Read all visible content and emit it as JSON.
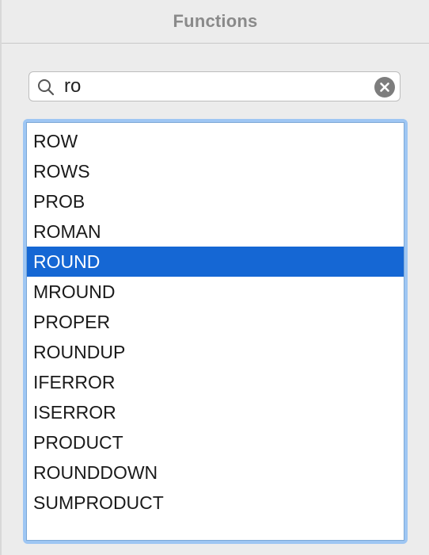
{
  "header": {
    "title": "Functions"
  },
  "search": {
    "value": "ro",
    "icon": "magnifying-glass-icon",
    "clear_icon": "clear-x-circle-icon"
  },
  "list": {
    "selected": "ROUND",
    "items": [
      "ROW",
      "ROWS",
      "PROB",
      "ROMAN",
      "ROUND",
      "MROUND",
      "PROPER",
      "ROUNDUP",
      "IFERROR",
      "ISERROR",
      "PRODUCT",
      "ROUNDDOWN",
      "SUMPRODUCT"
    ]
  },
  "colors": {
    "selection": "#1567d4",
    "focus_ring": "#9ec6f3",
    "header_text": "#8a8a8a"
  }
}
